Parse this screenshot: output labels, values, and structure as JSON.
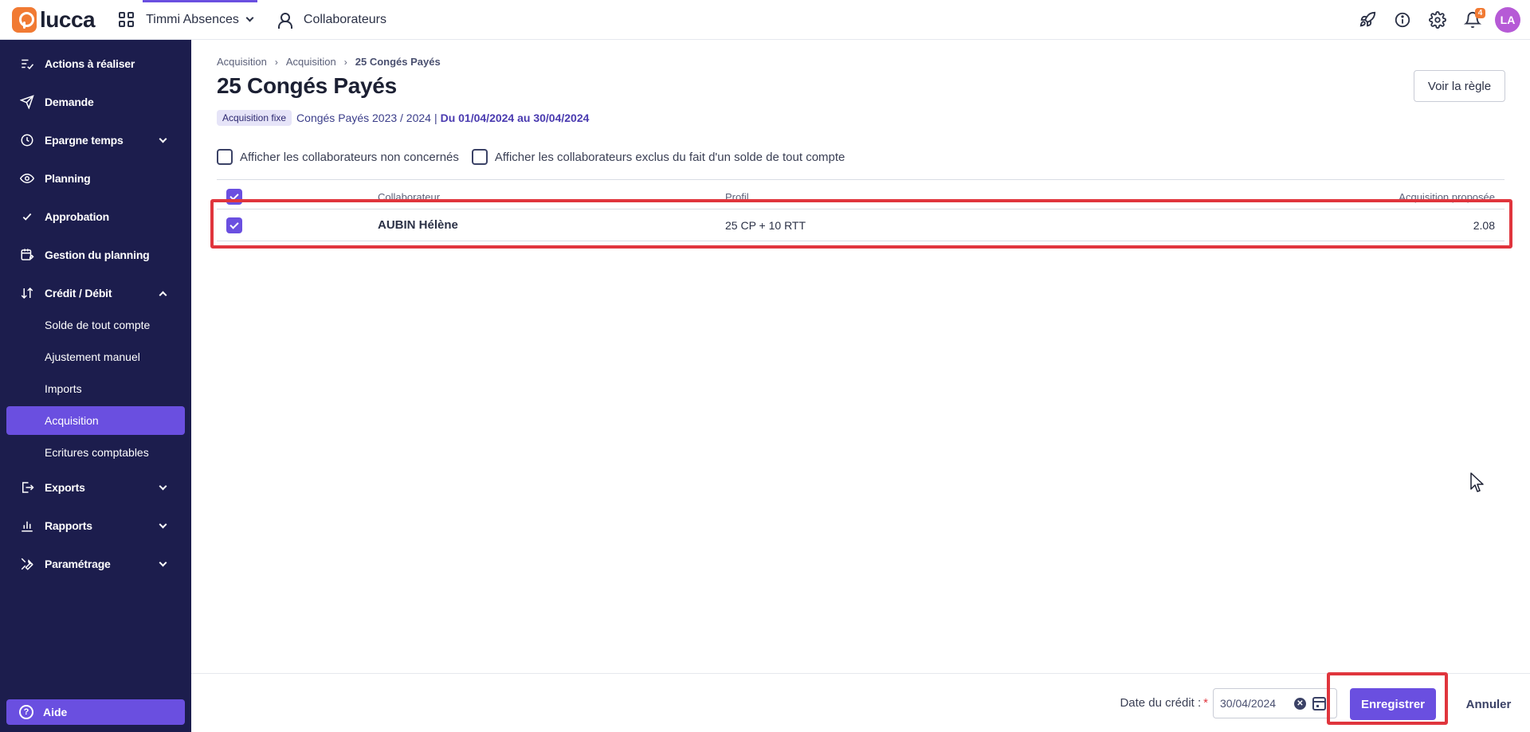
{
  "topbar": {
    "logo_text": "lucca",
    "app_name": "Timmi Absences",
    "collaborators_label": "Collaborateurs",
    "notifications_count": "4",
    "avatar_initials": "LA",
    "accent_color": "#6a4fe0",
    "icons": [
      "rocket-icon",
      "info-icon",
      "gear-icon",
      "bell-icon"
    ]
  },
  "sidebar": {
    "items": [
      {
        "label": "Actions à réaliser",
        "icon": "tasks-icon"
      },
      {
        "label": "Demande",
        "icon": "send-icon"
      },
      {
        "label": "Epargne temps",
        "icon": "clock-icon",
        "expandable": true
      },
      {
        "label": "Planning",
        "icon": "eye-icon"
      },
      {
        "label": "Approbation",
        "icon": "check-icon"
      },
      {
        "label": "Gestion du planning",
        "icon": "calendar-edit-icon"
      },
      {
        "label": "Crédit / Débit",
        "icon": "sort-icon",
        "expanded": true
      }
    ],
    "credit_sub_items": [
      {
        "label": "Solde de tout compte"
      },
      {
        "label": "Ajustement manuel"
      },
      {
        "label": "Imports"
      },
      {
        "label": "Acquisition",
        "active": true
      },
      {
        "label": "Ecritures comptables"
      }
    ],
    "bottom_items": [
      {
        "label": "Exports",
        "icon": "export-icon"
      },
      {
        "label": "Rapports",
        "icon": "chart-icon"
      },
      {
        "label": "Paramétrage",
        "icon": "tools-icon"
      }
    ],
    "help_label": "Aide",
    "background_color": "#1c1d4d"
  },
  "main": {
    "breadcrumb": [
      "Acquisition",
      "Acquisition",
      "25 Congés Payés"
    ],
    "title": "25 Congés Payés",
    "tag": "Acquisition fixe",
    "plan": "Congés Payés 2023 / 2024",
    "separator": "|",
    "range": "Du 01/04/2024 au 30/04/2024",
    "rule_button": "Voir la règle",
    "filters": [
      {
        "label": "Afficher les collaborateurs non concernés",
        "checked": false
      },
      {
        "label": "Afficher les collaborateurs exclus du fait d'un solde de tout compte",
        "checked": false
      }
    ],
    "table": {
      "columns": [
        "Collaborateur",
        "Profil",
        "Acquisition proposée"
      ],
      "rows": [
        {
          "checked": true,
          "collaborator": "AUBIN Hélène",
          "profile": "25 CP + 10 RTT",
          "acquisition": "2.08"
        }
      ]
    }
  },
  "footer": {
    "date_label": "Date du crédit :",
    "required_mark": "*",
    "date_value": "30/04/2024",
    "save_label": "Enregistrer",
    "cancel_label": "Annuler"
  }
}
